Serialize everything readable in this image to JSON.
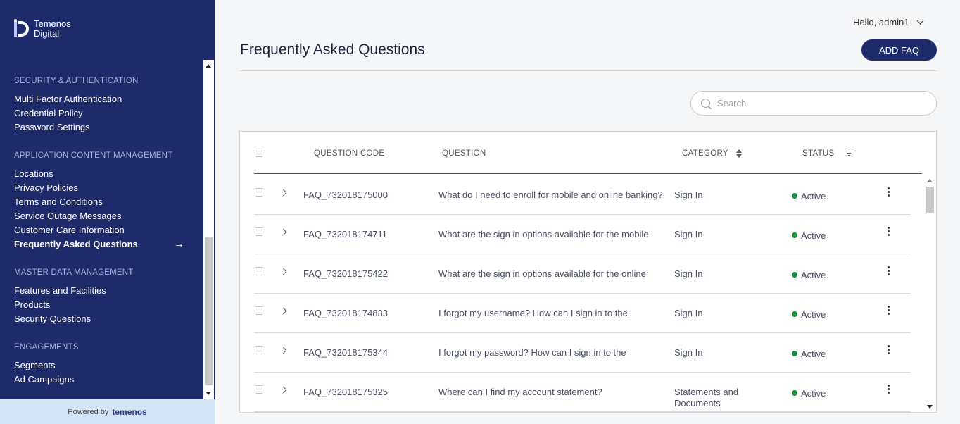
{
  "brand": {
    "line1": "Temenos",
    "line2": "Digital"
  },
  "sidebar": {
    "sections": [
      {
        "header": "SECURITY & AUTHENTICATION",
        "items": [
          "Multi Factor Authentication",
          "Credential Policy",
          "Password Settings"
        ]
      },
      {
        "header": "APPLICATION CONTENT MANAGEMENT",
        "items": [
          "Locations",
          "Privacy Policies",
          "Terms and Conditions",
          "Service Outage Messages",
          "Customer Care Information",
          "Frequently Asked Questions"
        ]
      },
      {
        "header": "MASTER DATA MANAGEMENT",
        "items": [
          "Features and Facilities",
          "Products",
          "Security Questions"
        ]
      },
      {
        "header": "ENGAGEMENTS",
        "items": [
          "Segments",
          "Ad Campaigns"
        ]
      }
    ],
    "active_item": "Frequently Asked Questions",
    "powered_by": "Powered by",
    "powered_brand": "temenos"
  },
  "header": {
    "greeting": "Hello, admin1"
  },
  "page": {
    "title": "Frequently Asked Questions",
    "add_button": "ADD FAQ"
  },
  "search": {
    "placeholder": "Search",
    "value": ""
  },
  "table": {
    "columns": {
      "code": "QUESTION CODE",
      "question": "QUESTION",
      "category": "CATEGORY",
      "status": "STATUS"
    },
    "rows": [
      {
        "code": "FAQ_732018175000",
        "question": "What do I need to enroll for mobile and online banking?",
        "category": "Sign In",
        "status": "Active"
      },
      {
        "code": "FAQ_732018174711",
        "question": "What are the sign in options available for the mobile",
        "category": "Sign In",
        "status": "Active"
      },
      {
        "code": "FAQ_732018175422",
        "question": "What are the sign in options available for the online",
        "category": "Sign In",
        "status": "Active"
      },
      {
        "code": "FAQ_732018174833",
        "question": "I forgot my username? How can I sign in to the",
        "category": "Sign In",
        "status": "Active"
      },
      {
        "code": "FAQ_732018175344",
        "question": "I forgot my password? How can I sign in to the",
        "category": "Sign In",
        "status": "Active"
      },
      {
        "code": "FAQ_732018175325",
        "question": "Where can I find my account statement?",
        "category": "Statements and Documents",
        "status": "Active"
      }
    ]
  },
  "colors": {
    "sidebar_bg": "#1f2a6b",
    "accent": "#1f2a6b",
    "active_status": "#1e8a3c",
    "footer_bg": "#d3e4f5"
  }
}
